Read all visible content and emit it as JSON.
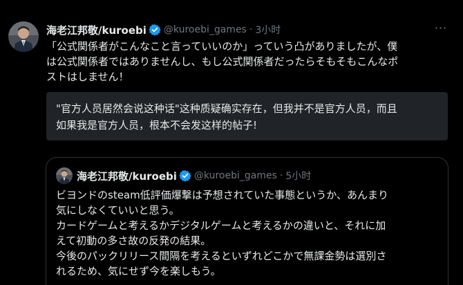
{
  "tweet": {
    "author": {
      "display_name": "海老江邦敬/kuroebi",
      "handle": "@kuroebi_games",
      "separator": "·",
      "time": "3小时",
      "verified_color": "#1d9bf0"
    },
    "more_icon": "···",
    "body_lines": [
      "「公式関係者がこんなこと言っていいのか」っていう凸がありましたが、僕",
      "は公式関係者ではありませんし、もし公式関係者だったらそもそもこんなポ",
      "ストはしません！"
    ],
    "translation_lines": [
      "\"官方人员居然会说这种话\"这种质疑确实存在，但我并不是官方人员，而且",
      "如果我是官方人员，根本不会发这样的帖子!"
    ]
  },
  "quoted_tweet": {
    "author": {
      "display_name": "海老江邦敬/kuroebi",
      "handle": "@kuroebi_games",
      "separator": "·",
      "time": "5小时"
    },
    "body_lines": [
      "ビヨンドのsteam低評価爆撃は予想されていた事態というか、あんまり",
      "気にしなくていいと思う。",
      "カードゲームと考えるかデジタルゲームと考えるかの違いと、それに加",
      "えて初動の多さ故の反発の結果。",
      "今後のパックリリース間隔を考えるといずれどこかで無課金勢は選別さ",
      "れるため、気にせず今を楽しもう。"
    ]
  },
  "colors": {
    "background": "#000000",
    "text_primary": "#e7e9ea",
    "text_secondary": "#71767b",
    "translation_bg": "#202327",
    "border": "#2f3336",
    "verified": "#1d9bf0"
  }
}
